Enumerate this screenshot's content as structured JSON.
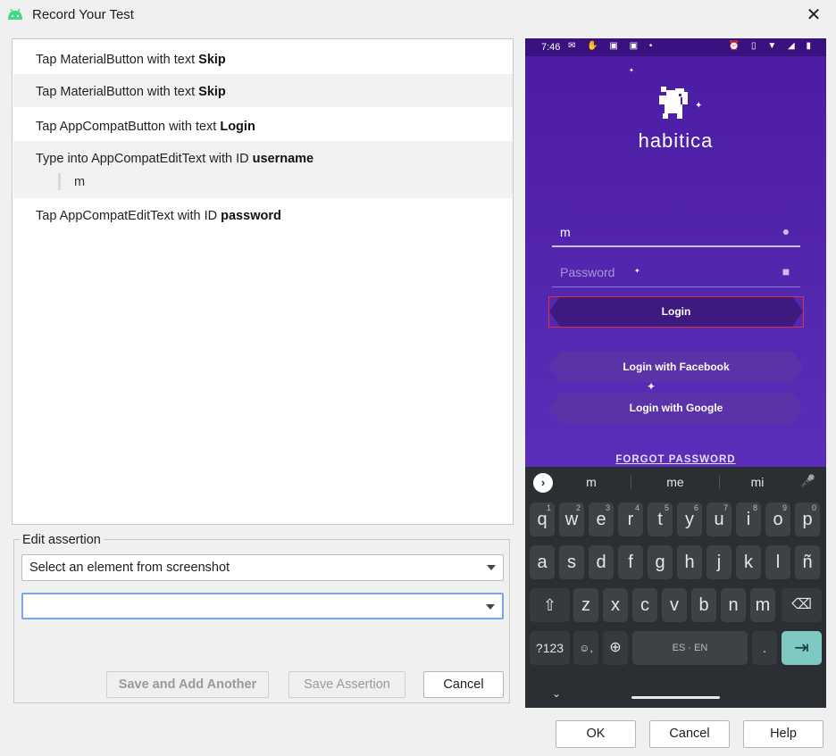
{
  "window": {
    "title": "Record Your Test",
    "close_glyph": "✕"
  },
  "steps": [
    {
      "prefix": "Tap MaterialButton with text ",
      "target": "Skip"
    },
    {
      "prefix": "Tap MaterialButton with text ",
      "target": "Skip"
    },
    {
      "prefix": "Tap AppCompatButton with text ",
      "target": "Login"
    },
    {
      "prefix": "Type into AppCompatEditText with ID ",
      "target": "username",
      "value": "m"
    },
    {
      "prefix": "Tap AppCompatEditText with ID ",
      "target": "password"
    }
  ],
  "assertion": {
    "legend": "Edit assertion",
    "element_select": "Select an element from screenshot",
    "assertion_select": "",
    "save_add_label": "Save and Add Another",
    "save_label": "Save Assertion",
    "cancel_label": "Cancel"
  },
  "device": {
    "status": {
      "time": "7:46",
      "left_icons": "✉ ✋ ▣ ▣ •",
      "right_icons": "⏰ ▯ ▼ ◢ ▮"
    },
    "brand": "habitica",
    "username_value": "m",
    "password_placeholder": "Password",
    "login_label": "Login",
    "facebook_label": "Login with Facebook",
    "google_label": "Login with Google",
    "forgot_label": "FORGOT PASSWORD",
    "suggestions": [
      "m",
      "me",
      "mi"
    ],
    "keyboard_rows": [
      [
        "q",
        "w",
        "e",
        "r",
        "t",
        "y",
        "u",
        "i",
        "o",
        "p"
      ],
      [
        "a",
        "s",
        "d",
        "f",
        "g",
        "h",
        "j",
        "k",
        "l",
        "ñ"
      ],
      [
        "z",
        "x",
        "c",
        "v",
        "b",
        "n",
        "m"
      ]
    ],
    "row1_hints": [
      "1",
      "2",
      "3",
      "4",
      "5",
      "6",
      "7",
      "8",
      "9",
      "0"
    ],
    "symbols_label": "?123",
    "emoji_key": "☺,",
    "space_label": "ES · EN",
    "period_label": ".",
    "enter_glyph": "⇥"
  },
  "dialog": {
    "ok_label": "OK",
    "cancel_label": "Cancel",
    "help_label": "Help"
  }
}
